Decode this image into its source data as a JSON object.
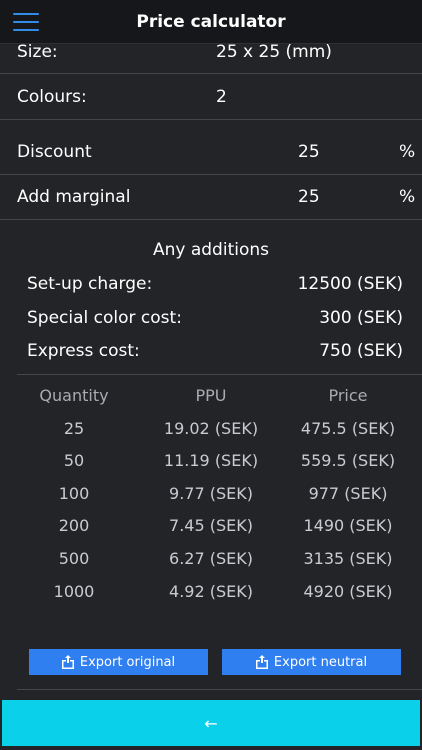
{
  "header": {
    "title": "Price calculator"
  },
  "specs": {
    "size_label": "Size:",
    "size_value": "25 x 25 (mm)",
    "colours_label": "Colours:",
    "colours_value": "2"
  },
  "pricing": {
    "discount_label": "Discount",
    "discount_value": "25",
    "discount_unit": "%",
    "marginal_label": "Add marginal",
    "marginal_value": "25",
    "marginal_unit": "%"
  },
  "additions": {
    "title": "Any additions",
    "items": [
      {
        "label": "Set-up charge:",
        "value": "12500 (SEK)"
      },
      {
        "label": "Special color cost:",
        "value": "300 (SEK)"
      },
      {
        "label": "Express cost:",
        "value": "750 (SEK)"
      }
    ]
  },
  "table": {
    "headers": [
      "Quantity",
      "PPU",
      "Price"
    ],
    "rows": [
      [
        "25",
        "19.02 (SEK)",
        "475.5 (SEK)"
      ],
      [
        "50",
        "11.19 (SEK)",
        "559.5 (SEK)"
      ],
      [
        "100",
        "9.77 (SEK)",
        "977 (SEK)"
      ],
      [
        "200",
        "7.45 (SEK)",
        "1490 (SEK)"
      ],
      [
        "500",
        "6.27 (SEK)",
        "3135 (SEK)"
      ],
      [
        "1000",
        "4.92 (SEK)",
        "4920 (SEK)"
      ]
    ]
  },
  "actions": {
    "export_original": "Export original",
    "export_neutral": "Export neutral",
    "back_glyph": "←"
  },
  "colors": {
    "accent": "#2f7ff0",
    "bottom_bar": "#0bd0ea",
    "background": "#232428"
  }
}
